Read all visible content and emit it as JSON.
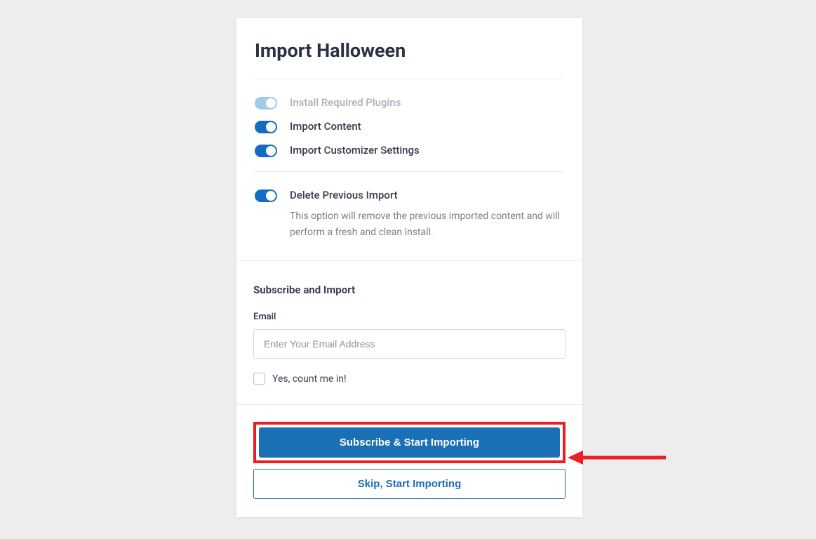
{
  "title": "Import Halloween",
  "options": {
    "install_plugins": {
      "label": "Install Required Plugins"
    },
    "import_content": {
      "label": "Import Content"
    },
    "import_customizer": {
      "label": "Import Customizer Settings"
    }
  },
  "delete": {
    "label": "Delete Previous Import",
    "description": "This option will remove the previous imported content and will perform a fresh and clean install."
  },
  "subscribe": {
    "heading": "Subscribe and Import",
    "email_label": "Email",
    "email_placeholder": "Enter Your Email Address",
    "optin_label": "Yes, count me in!"
  },
  "buttons": {
    "primary": "Subscribe & Start Importing",
    "secondary": "Skip, Start Importing"
  }
}
